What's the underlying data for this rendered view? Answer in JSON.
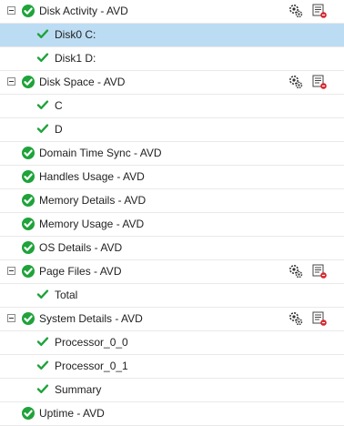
{
  "tree": {
    "rows": [
      {
        "label": "Disk Activity - AVD",
        "level": 0,
        "expandable": true,
        "actions": true
      },
      {
        "label": "Disk0 C:",
        "level": 1,
        "selected": true
      },
      {
        "label": "Disk1 D:",
        "level": 1
      },
      {
        "label": "Disk Space - AVD",
        "level": 0,
        "expandable": true,
        "actions": true
      },
      {
        "label": "C",
        "level": 1
      },
      {
        "label": "D",
        "level": 1
      },
      {
        "label": "Domain Time Sync - AVD",
        "level": 0
      },
      {
        "label": "Handles Usage - AVD",
        "level": 0
      },
      {
        "label": "Memory Details - AVD",
        "level": 0
      },
      {
        "label": "Memory Usage - AVD",
        "level": 0
      },
      {
        "label": "OS Details - AVD",
        "level": 0
      },
      {
        "label": "Page Files - AVD",
        "level": 0,
        "expandable": true,
        "actions": true
      },
      {
        "label": "Total",
        "level": 1
      },
      {
        "label": "System Details - AVD",
        "level": 0,
        "expandable": true,
        "actions": true
      },
      {
        "label": "Processor_0_0",
        "level": 1
      },
      {
        "label": "Processor_0_1",
        "level": 1
      },
      {
        "label": "Summary",
        "level": 1
      },
      {
        "label": "Uptime - AVD",
        "level": 0
      }
    ]
  },
  "icons": {
    "collapse": "collapse-toggle-icon",
    "status": "status-ok-icon",
    "check": "checkmark-icon",
    "configure": "configure-gears-icon",
    "report": "report-edit-icon"
  },
  "colors": {
    "ok_green": "#1fa33a",
    "selected_row": "#bcdcf3",
    "row_divider": "#e9e9e9",
    "report_red": "#d9272e"
  }
}
